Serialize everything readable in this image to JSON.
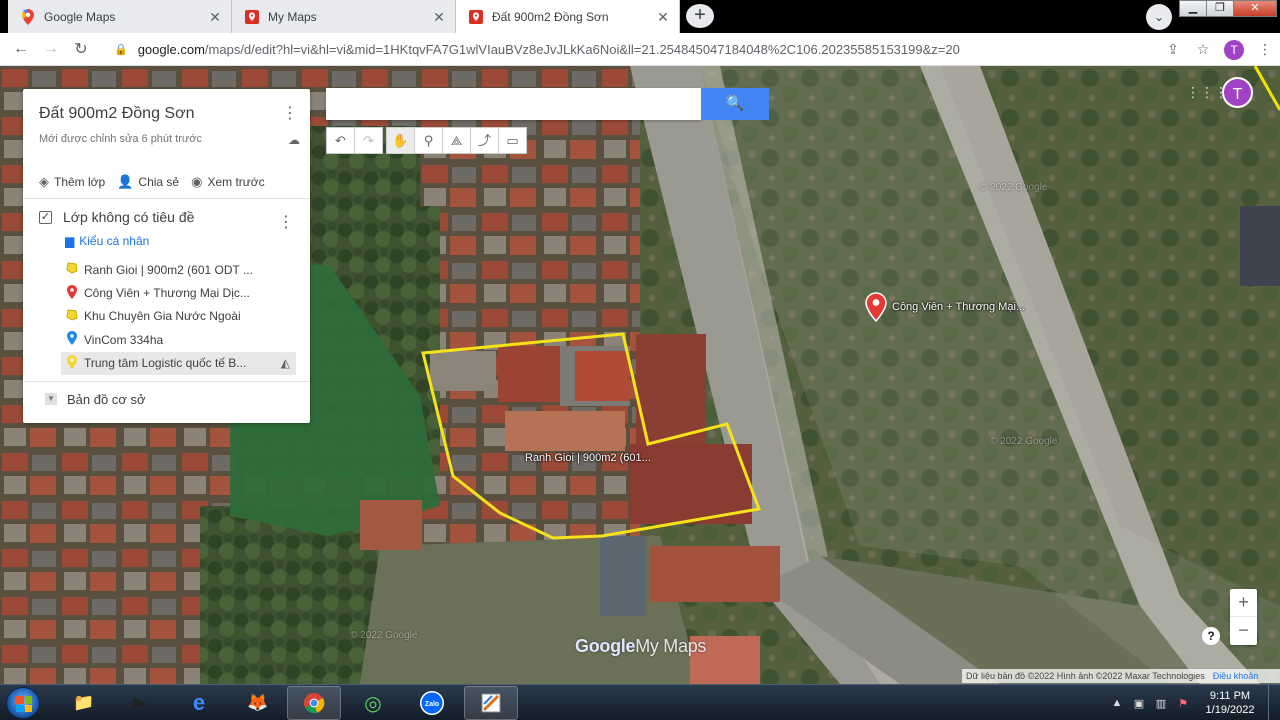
{
  "browser": {
    "tabs": [
      {
        "title": "Google Maps",
        "icon": "google-maps-pin-icon"
      },
      {
        "title": "My Maps",
        "icon": "my-maps-icon"
      },
      {
        "title": "Đất 900m2 Đồng Sơn",
        "icon": "my-maps-icon"
      }
    ],
    "active_tab": 2,
    "url_host": "google.com",
    "url_path": "/maps/d/edit?hl=vi&hl=vi&mid=1HKtqvFA7G1wlVIauBVz8eJvJLkKa6Noi&ll=21.254845047184048%2C106.20235585153199&z=20",
    "avatar_letter": "T"
  },
  "panel": {
    "title": "Đất 900m2 Đồng Sơn",
    "edited": "Mới được chỉnh sửa 6 phút trước",
    "actions": {
      "add_layer": "Thêm lớp",
      "share": "Chia sẻ",
      "preview": "Xem trước"
    },
    "layer": {
      "name": "Lớp không có tiêu đề",
      "style_link": "Kiểu cá nhân",
      "items": [
        {
          "label": "Ranh Gioi | 900m2 (601 ODT ...",
          "icon": "polygon-icon",
          "color": "#f5d631"
        },
        {
          "label": "Công Viên + Thương Mại Dịc...",
          "icon": "map-pin-icon",
          "color": "#e53935"
        },
        {
          "label": "Khu Chuyên Gia Nước Ngoài",
          "icon": "polygon-icon",
          "color": "#f5d631"
        },
        {
          "label": "VinCom 334ha",
          "icon": "map-pin-icon",
          "color": "#1e88e5"
        },
        {
          "label": "Trung tâm Logistic quốc tế B...",
          "icon": "map-pin-icon",
          "color": "#f5d631"
        }
      ]
    },
    "base_map": "Bản đồ cơ sở"
  },
  "search": {
    "placeholder": "",
    "value": ""
  },
  "map": {
    "labels": {
      "parcel": "Ranh Gioi | 900m2 (601...",
      "park": "Công Viên + Thương Mại..."
    },
    "watermarks": [
      "© 2022 Google"
    ],
    "logo_google": "Google",
    "logo_mymaps": "My Maps",
    "attribution": "Dữ liệu bản đồ ©2022 Hình ảnh ©2022 Maxar Technologies",
    "terms": "Điều khoản",
    "zoom_in": "+",
    "zoom_out": "−",
    "help": "?"
  },
  "taskbar": {
    "time": "9:11 PM",
    "date": "1/19/2022"
  }
}
